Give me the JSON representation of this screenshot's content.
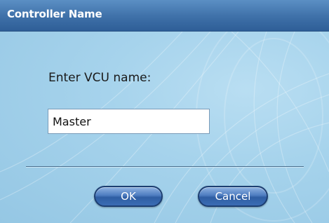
{
  "dialog": {
    "title": "Controller Name",
    "prompt_label": "Enter VCU name:",
    "name_input": {
      "value": "Master",
      "placeholder": ""
    },
    "buttons": {
      "ok_label": "OK",
      "cancel_label": "Cancel"
    }
  },
  "colors": {
    "titlebar": "#3e70a8",
    "background": "#9ccbe6",
    "button": "#3a6cb4"
  }
}
